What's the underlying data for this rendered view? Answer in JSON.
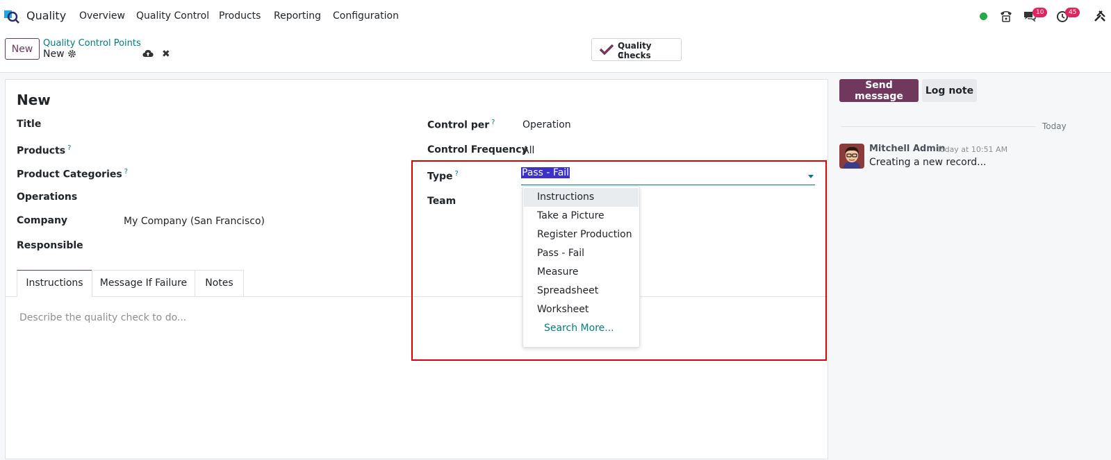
{
  "navbar": {
    "app_name": "Quality",
    "menu": [
      "Overview",
      "Quality Control",
      "Products",
      "Reporting",
      "Configuration"
    ],
    "messages_count": "10",
    "activities_count": "45",
    "status_color": "#28a745"
  },
  "control_panel": {
    "new_label": "New",
    "breadcrumb_parent": "Quality Control Points",
    "breadcrumb_current": "New",
    "smart_button": {
      "label": "Quality Checks",
      "value": "0"
    }
  },
  "form": {
    "record_title": "New",
    "left_fields": [
      {
        "label": "Title",
        "help": false,
        "value": ""
      },
      {
        "label": "Products",
        "help": true,
        "value": ""
      },
      {
        "label": "Product Categories",
        "help": true,
        "value": ""
      },
      {
        "label": "Operations",
        "help": false,
        "value": ""
      },
      {
        "label": "Company",
        "help": false,
        "value": "My Company (San Francisco)"
      },
      {
        "label": "Responsible",
        "help": false,
        "value": ""
      }
    ],
    "right_fields": {
      "control_per_label": "Control per",
      "control_per_value": "Operation",
      "control_frequency_label": "Control Frequency",
      "control_frequency_value": "All",
      "type_label": "Type",
      "type_value": "Pass - Fail",
      "team_label": "Team"
    },
    "help_mark": "?"
  },
  "type_dropdown": {
    "options": [
      "Instructions",
      "Take a Picture",
      "Register Production",
      "Pass - Fail",
      "Measure",
      "Spreadsheet",
      "Worksheet"
    ],
    "search_more": "Search More..."
  },
  "tabs": {
    "items": [
      "Instructions",
      "Message If Failure",
      "Notes"
    ],
    "placeholder": "Describe the quality check to do..."
  },
  "chatter": {
    "send_message": "Send message",
    "log_note": "Log note",
    "date_separator": "Today",
    "message": {
      "author": "Mitchell Admin",
      "time": "Today at 10:51 AM",
      "body": "Creating a new record..."
    }
  },
  "colors": {
    "brand": "#71385e",
    "accent": "#017e84",
    "highlight": "#e00000"
  }
}
